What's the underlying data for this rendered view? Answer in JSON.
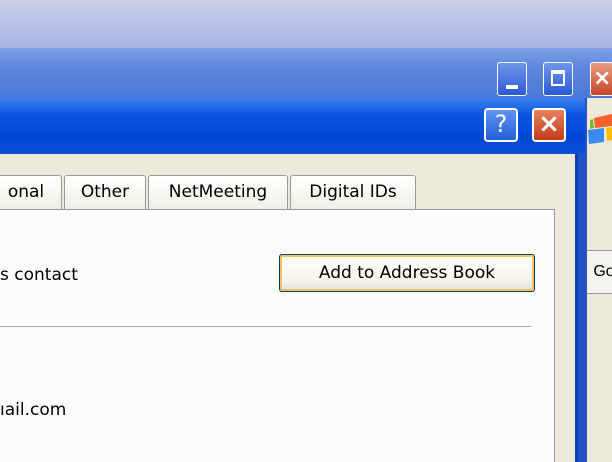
{
  "background_window": {
    "close_glyph": "×"
  },
  "dialog": {
    "help_glyph": "?",
    "close_glyph": "×",
    "tabs": [
      {
        "label": "onal"
      },
      {
        "label": "Other"
      },
      {
        "label": "NetMeeting"
      },
      {
        "label": "Digital IDs"
      }
    ],
    "contact_text": "s contact",
    "add_button_label": "Add to Address Book",
    "email_text": "ıail.com"
  },
  "background_toolbar": {
    "go_label": "Go"
  },
  "colors": {
    "titlebar_blue": "#0048d8",
    "face": "#ece9d8",
    "close_red": "#c23b1b",
    "button_focus": "#f5c25b"
  }
}
